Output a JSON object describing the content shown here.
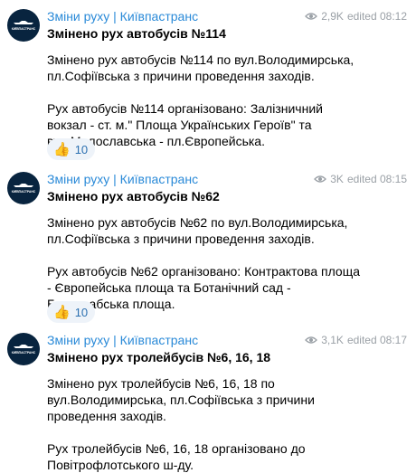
{
  "posts": [
    {
      "channel": "Зміни руху | Київпастранс",
      "views": "2,9K",
      "edited": "edited 08:12",
      "headline": "Змінено рух автобусів  №114",
      "paragraphs": [
        "Змінено рух автобусів  №114 по вул.Володимирська, пл.Софіївська з причини проведення заходів.",
        "Рух автобусів  №114 організовано:  Залізничний вокзал - ст. м.\" Площа Українських Героїв\" та вул.Милославська - пл.Європейська."
      ],
      "reaction": {
        "emoji": "👍",
        "count": "10"
      }
    },
    {
      "channel": "Зміни руху | Київпастранс",
      "views": "3K",
      "edited": "edited 08:15",
      "headline": "Змінено рух автобусів  №62",
      "paragraphs": [
        "Змінено рух автобусів  №62 по вул.Володимирська, пл.Софіївська з причини проведення заходів.",
        "Рух автобусів  №62 організовано: Контрактова площа - Європейська площа та Ботанічний сад - Бессарабська площа."
      ],
      "reaction": {
        "emoji": "👍",
        "count": "10"
      }
    },
    {
      "channel": "Зміни руху | Київпастранс",
      "views": "3,1K",
      "edited": "edited 08:17",
      "headline": "Змінено рух тролейбусів  №6, 16, 18",
      "paragraphs": [
        "Змінено рух тролейбусів  №6, 16, 18  по вул.Володимирська, пл.Софіївська з причини проведення заходів.",
        "Рух тролейбусів  №6, 16, 18 організовано до Повітрофлотського ш-ду."
      ]
    }
  ],
  "avatar_text": "КИЇВПАСТРАНС",
  "colors": {
    "channel": "#2a8ad8",
    "avatar_bg": "#08243f",
    "meta": "#9aa0a6",
    "reaction_bg": "#eef3f9"
  },
  "icons": {
    "views": "eye-icon",
    "reaction": "thumbs-up-icon",
    "avatar": "kyivpastrans-logo"
  }
}
